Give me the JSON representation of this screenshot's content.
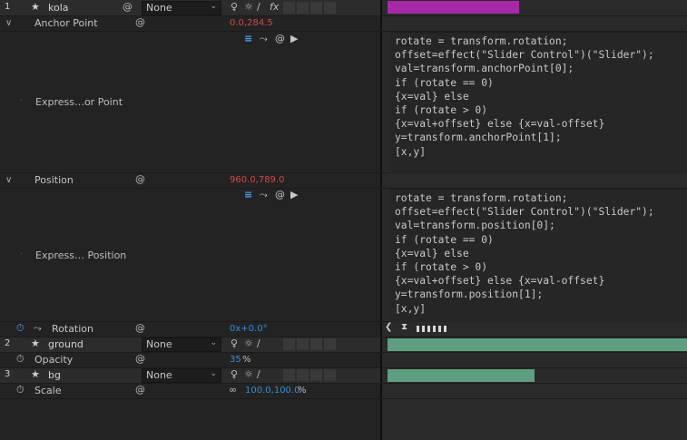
{
  "layers": [
    {
      "number": "1",
      "name": "kola",
      "parent": "None"
    },
    {
      "number": "2",
      "name": "ground",
      "parent": "None"
    },
    {
      "number": "3",
      "name": "bg",
      "parent": "None"
    }
  ],
  "properties": {
    "anchor_point": {
      "label": "Anchor Point",
      "value_x": "0.0",
      "value_sep": ",",
      "value_y": "284.5",
      "expr_label": "Express…or Point"
    },
    "position": {
      "label": "Position",
      "value_x": "960.0",
      "value_sep": ",",
      "value_y": "789.0",
      "expr_label": "Express… Position"
    },
    "rotation": {
      "label": "Rotation",
      "value": "0",
      "value_suffix": "x+0.0°"
    },
    "opacity": {
      "label": "Opacity",
      "value": "35",
      "unit": "%"
    },
    "scale": {
      "label": "Scale",
      "value_x": "100.0",
      "value_sep": ",",
      "value_y": "100.0",
      "unit": "%"
    }
  },
  "expressions": {
    "anchor_point": "rotate = transform.rotation;\noffset=effect(\"Slider Control\")(\"Slider\");\nval=transform.anchorPoint[0];\nif (rotate == 0)\n{x=val} else\nif (rotate > 0)\n{x=val+offset} else {x=val-offset}\ny=transform.anchorPoint[1];\n[x,y]",
    "position": "rotate = transform.rotation;\noffset=effect(\"Slider Control\")(\"Slider\");\nval=transform.position[0];\nif (rotate == 0)\n{x=val} else\nif (rotate > 0)\n{x=val+offset} else {x=val-offset}\ny=transform.position[1];\n[x,y]"
  },
  "icons": {
    "star": "★",
    "spiral": "@",
    "chevron": "∨",
    "dropdown_arrow": "⌄",
    "puppet": "♀",
    "sun": "☼",
    "slash": "∕",
    "fx": "fx",
    "stopwatch": "⏱",
    "graph": "⤳",
    "play": "▶",
    "equals": "=",
    "link": "∞"
  },
  "colors": {
    "kola_bar": "#a62aa8",
    "ground_bar": "#5f9e80",
    "bg_bar": "#5f9e80",
    "value_red": "#d04848",
    "value_blue": "#3c8bd6"
  },
  "timeline": {
    "kola_bar": {
      "start": 0.0,
      "end": 0.44
    },
    "ground_bar": {
      "start": 0.0,
      "end": 1.0
    },
    "bg_bar": {
      "start": 0.0,
      "end": 0.49
    }
  }
}
